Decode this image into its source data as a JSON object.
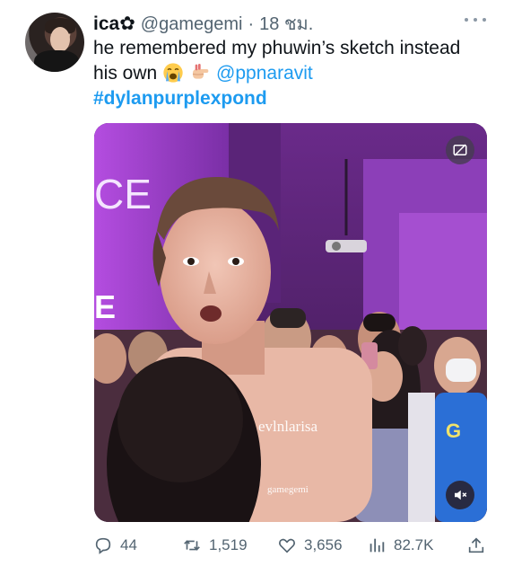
{
  "tweet": {
    "author": {
      "display_name": "ica✿",
      "handle": "@gamegemi",
      "separator": "·",
      "time": "18 ชม."
    },
    "text": {
      "line1": "he remembered my phuwin’s sketch instead",
      "line2_prefix": "his own",
      "emojis": [
        "loudly-crying-face-emoji",
        "backhand-index-pointing-right-emoji"
      ],
      "mention": "@ppnaravit",
      "hashtag": "#dylanpurplexpond"
    },
    "media": {
      "watermark_1": "evlnlarisa",
      "watermark_2": "gamegemi",
      "caption_icon": "closed-captions-icon",
      "mute_icon": "speaker-muted-icon"
    },
    "actions": {
      "replies": "44",
      "retweets": "1,519",
      "likes": "3,656",
      "views": "82.7K"
    }
  }
}
